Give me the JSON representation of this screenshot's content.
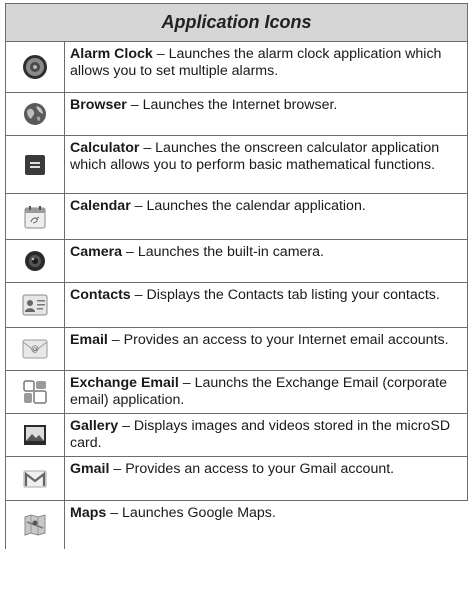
{
  "table": {
    "title": "Application Icons",
    "separator": " – ",
    "rows": [
      {
        "icon": "alarm-clock-icon",
        "name": "Alarm Clock",
        "desc": "Launches the alarm clock application which allows you to set multiple alarms."
      },
      {
        "icon": "browser-icon",
        "name": "Browser",
        "desc": "Launches the Internet browser."
      },
      {
        "icon": "calculator-icon",
        "name": "Calculator",
        "desc": "Launches the onscreen calculator application which allows you to perform basic mathematical functions."
      },
      {
        "icon": "calendar-icon",
        "name": "Calendar",
        "desc": "Launches the calendar application."
      },
      {
        "icon": "camera-icon",
        "name": "Camera",
        "desc": "Launches the built-in camera."
      },
      {
        "icon": "contacts-icon",
        "name": "Contacts",
        "desc": "Displays the Contacts tab listing your contacts."
      },
      {
        "icon": "email-icon",
        "name": "Email",
        "desc": "Provides an access to your Internet email accounts."
      },
      {
        "icon": "exchange-email-icon",
        "name": "Exchange Email",
        "desc": "Launchs the Exchange Email (corporate email) application."
      },
      {
        "icon": "gallery-icon",
        "name": "Gallery",
        "desc": "Displays images and videos stored in the microSD card."
      },
      {
        "icon": "gmail-icon",
        "name": "Gmail",
        "desc": "Provides an access to your Gmail account."
      },
      {
        "icon": "maps-icon",
        "name": "Maps",
        "desc": "Launches Google Maps."
      }
    ]
  }
}
